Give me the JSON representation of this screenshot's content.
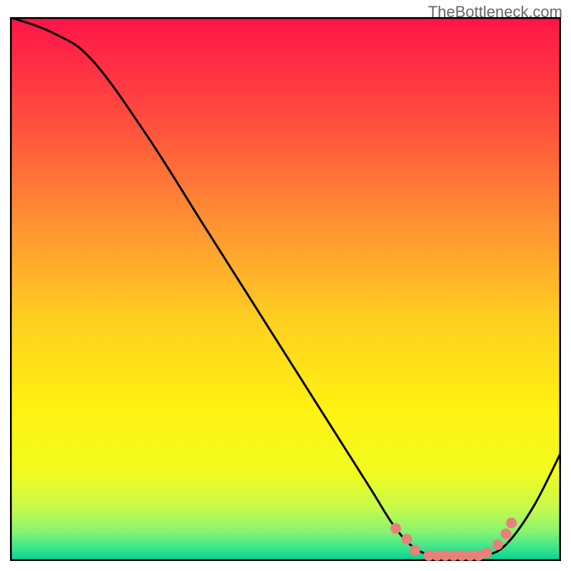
{
  "attribution": "TheBottleneck.com",
  "chart_data": {
    "type": "line",
    "title": "",
    "xlabel": "",
    "ylabel": "",
    "xlim": [
      0,
      100
    ],
    "ylim": [
      0,
      100
    ],
    "curve": [
      {
        "x": 0,
        "y": 100
      },
      {
        "x": 8,
        "y": 97
      },
      {
        "x": 15,
        "y": 92
      },
      {
        "x": 25,
        "y": 78
      },
      {
        "x": 35,
        "y": 62
      },
      {
        "x": 45,
        "y": 46
      },
      {
        "x": 55,
        "y": 30
      },
      {
        "x": 65,
        "y": 14
      },
      {
        "x": 70,
        "y": 6
      },
      {
        "x": 74,
        "y": 2
      },
      {
        "x": 78,
        "y": 1
      },
      {
        "x": 82,
        "y": 1
      },
      {
        "x": 86,
        "y": 1
      },
      {
        "x": 90,
        "y": 3
      },
      {
        "x": 95,
        "y": 10
      },
      {
        "x": 100,
        "y": 20
      }
    ],
    "markers": [
      {
        "x": 70,
        "y": 6
      },
      {
        "x": 72,
        "y": 4
      },
      {
        "x": 73.5,
        "y": 2
      },
      {
        "x": 76,
        "y": 1
      },
      {
        "x": 77.5,
        "y": 1
      },
      {
        "x": 79,
        "y": 1
      },
      {
        "x": 80.5,
        "y": 1
      },
      {
        "x": 82,
        "y": 1
      },
      {
        "x": 83.5,
        "y": 1
      },
      {
        "x": 85,
        "y": 1
      },
      {
        "x": 86.5,
        "y": 1.5
      },
      {
        "x": 88.5,
        "y": 3
      },
      {
        "x": 90,
        "y": 5
      },
      {
        "x": 91,
        "y": 7
      }
    ],
    "marker_color": "#e8817a",
    "background_gradient": {
      "stops": [
        {
          "offset": 0.0,
          "color": "#ff1448"
        },
        {
          "offset": 0.18,
          "color": "#ff4a3f"
        },
        {
          "offset": 0.38,
          "color": "#ff9232"
        },
        {
          "offset": 0.56,
          "color": "#ffd020"
        },
        {
          "offset": 0.72,
          "color": "#fff210"
        },
        {
          "offset": 0.84,
          "color": "#f0fb20"
        },
        {
          "offset": 0.9,
          "color": "#c8fa4a"
        },
        {
          "offset": 0.945,
          "color": "#8af46e"
        },
        {
          "offset": 0.975,
          "color": "#3be68e"
        },
        {
          "offset": 0.995,
          "color": "#0fd490"
        },
        {
          "offset": 1.0,
          "color": "#0fd490"
        }
      ]
    },
    "border_color": "#000000"
  }
}
